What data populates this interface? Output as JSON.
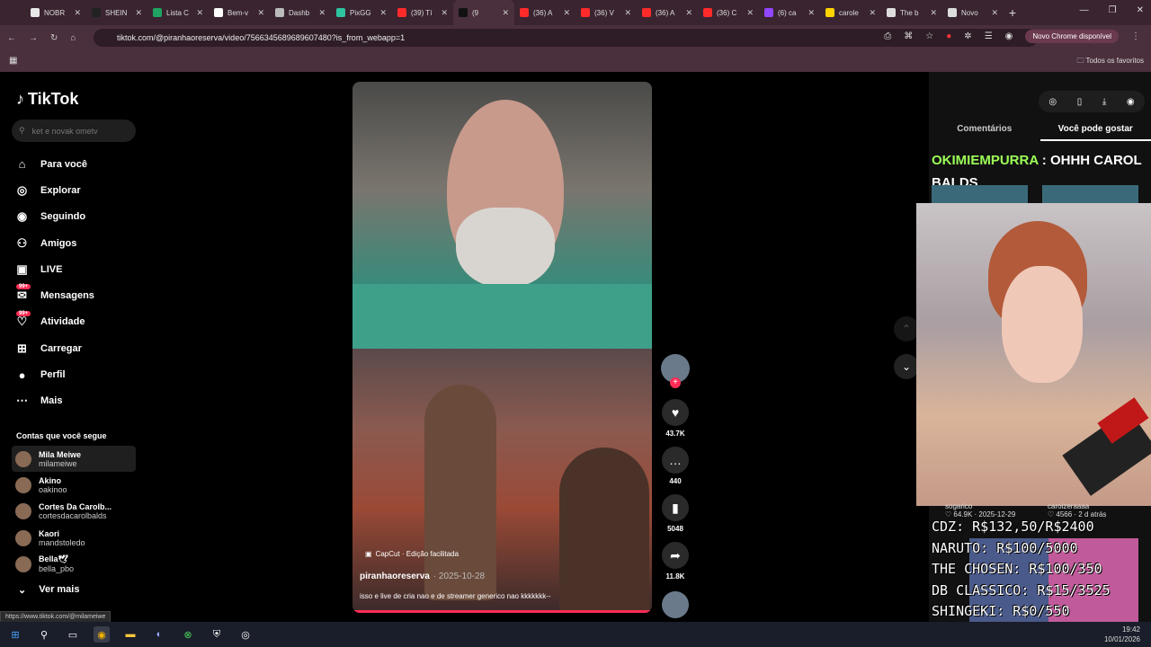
{
  "browser": {
    "tabs": [
      {
        "title": "NOBR",
        "color": "#e8e8e8"
      },
      {
        "title": "SHEIN",
        "color": "#222222"
      },
      {
        "title": "Lista C",
        "color": "#1fa463"
      },
      {
        "title": "Bem-v",
        "color": "#ffffff"
      },
      {
        "title": "Dashb",
        "color": "#bbbbbb"
      },
      {
        "title": "PixGG",
        "color": "#2ec4a0"
      },
      {
        "title": "(39) Tí",
        "color": "#ff2a2a"
      },
      {
        "title": "(9",
        "color": "#111111",
        "active": true
      },
      {
        "title": "(36) A",
        "color": "#ff2a2a"
      },
      {
        "title": "(36) V",
        "color": "#ff2a2a"
      },
      {
        "title": "(36) A",
        "color": "#ff2a2a"
      },
      {
        "title": "(36) C",
        "color": "#ff2a2a"
      },
      {
        "title": "(6) ca",
        "color": "#9146ff"
      },
      {
        "title": "carole",
        "color": "#ffd400"
      },
      {
        "title": "The b",
        "color": "#dddddd"
      },
      {
        "title": "Novo",
        "color": "#dddddd"
      }
    ],
    "url": "tiktok.com/@piranhaoreserva/video/7566345689689607480?is_from_webapp=1",
    "new_chrome_label": "Novo Chrome disponível",
    "bookmarks_all": "Todos os favoritos",
    "status_url": "https://www.tiktok.com/@milameiwe"
  },
  "sidebar": {
    "logo": "TikTok",
    "search_placeholder": "ket e novak ometv",
    "nav": [
      {
        "label": "Para você",
        "icon": "home-icon"
      },
      {
        "label": "Explorar",
        "icon": "compass-icon"
      },
      {
        "label": "Seguindo",
        "icon": "avatar-icon"
      },
      {
        "label": "Amigos",
        "icon": "friends-icon"
      },
      {
        "label": "LIVE",
        "icon": "live-icon"
      },
      {
        "label": "Mensagens",
        "icon": "messages-icon",
        "badge": "99+"
      },
      {
        "label": "Atividade",
        "icon": "activity-icon",
        "badge": "99+"
      },
      {
        "label": "Carregar",
        "icon": "upload-icon"
      },
      {
        "label": "Perfil",
        "icon": "profile-icon"
      },
      {
        "label": "Mais",
        "icon": "more-icon"
      }
    ],
    "following_header": "Contas que você segue",
    "following": [
      {
        "name": "Mila Meiwe",
        "handle": "milameiwe"
      },
      {
        "name": "Akino",
        "handle": "oakinoo"
      },
      {
        "name": "Cortes Da Carolb...",
        "handle": "cortesdacarolbalds"
      },
      {
        "name": "Kaori",
        "handle": "mandstoledo"
      },
      {
        "name": "Bella🕊",
        "handle": "bella_pbo"
      }
    ],
    "see_more": "Ver mais"
  },
  "video": {
    "capcut": "CapCut · Edição facilitada",
    "author": "piranhaoreserva",
    "date": "· 2025-10-28",
    "caption": "isso e live de cria nao e de streamer generico nao kkkkkkk--",
    "progress": 1.0
  },
  "actions": {
    "likes": "43.7K",
    "comments": "440",
    "saves": "5048",
    "shares": "11.8K"
  },
  "right_panel": {
    "tab_comments": "Comentários",
    "tab_suggestions": "Você pode gostar",
    "chat_user": "OKIMIEMPURRA",
    "chat_msg": ": OHHH CAROL BALDS",
    "suggest": [
      {
        "user": "sogarico",
        "meta": "♡ 64.9K · 2025-12-29"
      },
      {
        "user": "caroizeraaaa",
        "meta": "♡ 4566 · 2 d atrás"
      }
    ],
    "overlay_lines": [
      "CDZ: R$132,50/R$2400",
      "NARUTO: R$100/5000",
      "THE CHOSEN: R$100/350",
      "DB CLASSICO: R$15/3525",
      "SHINGEKI: R$0/550"
    ]
  },
  "taskbar": {
    "time": "19:42",
    "date": "10/01/2026"
  }
}
